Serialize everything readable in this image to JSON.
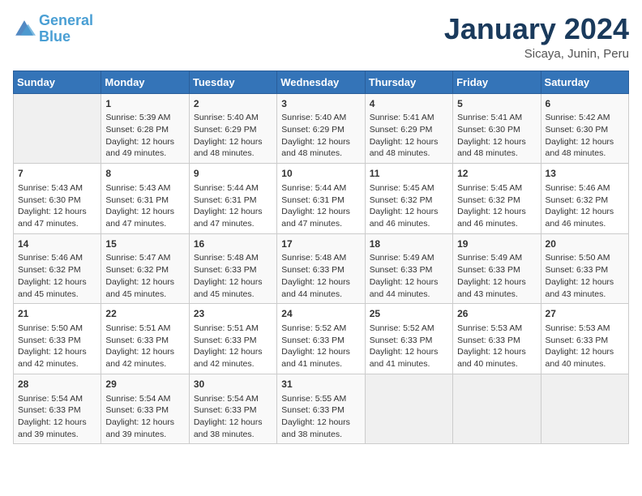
{
  "header": {
    "logo_general": "General",
    "logo_blue": "Blue",
    "month_title": "January 2024",
    "location": "Sicaya, Junin, Peru"
  },
  "days_of_week": [
    "Sunday",
    "Monday",
    "Tuesday",
    "Wednesday",
    "Thursday",
    "Friday",
    "Saturday"
  ],
  "weeks": [
    [
      {
        "day": "",
        "sunrise": "",
        "sunset": "",
        "daylight": ""
      },
      {
        "day": "1",
        "sunrise": "Sunrise: 5:39 AM",
        "sunset": "Sunset: 6:28 PM",
        "daylight": "Daylight: 12 hours and 49 minutes."
      },
      {
        "day": "2",
        "sunrise": "Sunrise: 5:40 AM",
        "sunset": "Sunset: 6:29 PM",
        "daylight": "Daylight: 12 hours and 48 minutes."
      },
      {
        "day": "3",
        "sunrise": "Sunrise: 5:40 AM",
        "sunset": "Sunset: 6:29 PM",
        "daylight": "Daylight: 12 hours and 48 minutes."
      },
      {
        "day": "4",
        "sunrise": "Sunrise: 5:41 AM",
        "sunset": "Sunset: 6:29 PM",
        "daylight": "Daylight: 12 hours and 48 minutes."
      },
      {
        "day": "5",
        "sunrise": "Sunrise: 5:41 AM",
        "sunset": "Sunset: 6:30 PM",
        "daylight": "Daylight: 12 hours and 48 minutes."
      },
      {
        "day": "6",
        "sunrise": "Sunrise: 5:42 AM",
        "sunset": "Sunset: 6:30 PM",
        "daylight": "Daylight: 12 hours and 48 minutes."
      }
    ],
    [
      {
        "day": "7",
        "sunrise": "Sunrise: 5:43 AM",
        "sunset": "Sunset: 6:30 PM",
        "daylight": "Daylight: 12 hours and 47 minutes."
      },
      {
        "day": "8",
        "sunrise": "Sunrise: 5:43 AM",
        "sunset": "Sunset: 6:31 PM",
        "daylight": "Daylight: 12 hours and 47 minutes."
      },
      {
        "day": "9",
        "sunrise": "Sunrise: 5:44 AM",
        "sunset": "Sunset: 6:31 PM",
        "daylight": "Daylight: 12 hours and 47 minutes."
      },
      {
        "day": "10",
        "sunrise": "Sunrise: 5:44 AM",
        "sunset": "Sunset: 6:31 PM",
        "daylight": "Daylight: 12 hours and 47 minutes."
      },
      {
        "day": "11",
        "sunrise": "Sunrise: 5:45 AM",
        "sunset": "Sunset: 6:32 PM",
        "daylight": "Daylight: 12 hours and 46 minutes."
      },
      {
        "day": "12",
        "sunrise": "Sunrise: 5:45 AM",
        "sunset": "Sunset: 6:32 PM",
        "daylight": "Daylight: 12 hours and 46 minutes."
      },
      {
        "day": "13",
        "sunrise": "Sunrise: 5:46 AM",
        "sunset": "Sunset: 6:32 PM",
        "daylight": "Daylight: 12 hours and 46 minutes."
      }
    ],
    [
      {
        "day": "14",
        "sunrise": "Sunrise: 5:46 AM",
        "sunset": "Sunset: 6:32 PM",
        "daylight": "Daylight: 12 hours and 45 minutes."
      },
      {
        "day": "15",
        "sunrise": "Sunrise: 5:47 AM",
        "sunset": "Sunset: 6:32 PM",
        "daylight": "Daylight: 12 hours and 45 minutes."
      },
      {
        "day": "16",
        "sunrise": "Sunrise: 5:48 AM",
        "sunset": "Sunset: 6:33 PM",
        "daylight": "Daylight: 12 hours and 45 minutes."
      },
      {
        "day": "17",
        "sunrise": "Sunrise: 5:48 AM",
        "sunset": "Sunset: 6:33 PM",
        "daylight": "Daylight: 12 hours and 44 minutes."
      },
      {
        "day": "18",
        "sunrise": "Sunrise: 5:49 AM",
        "sunset": "Sunset: 6:33 PM",
        "daylight": "Daylight: 12 hours and 44 minutes."
      },
      {
        "day": "19",
        "sunrise": "Sunrise: 5:49 AM",
        "sunset": "Sunset: 6:33 PM",
        "daylight": "Daylight: 12 hours and 43 minutes."
      },
      {
        "day": "20",
        "sunrise": "Sunrise: 5:50 AM",
        "sunset": "Sunset: 6:33 PM",
        "daylight": "Daylight: 12 hours and 43 minutes."
      }
    ],
    [
      {
        "day": "21",
        "sunrise": "Sunrise: 5:50 AM",
        "sunset": "Sunset: 6:33 PM",
        "daylight": "Daylight: 12 hours and 42 minutes."
      },
      {
        "day": "22",
        "sunrise": "Sunrise: 5:51 AM",
        "sunset": "Sunset: 6:33 PM",
        "daylight": "Daylight: 12 hours and 42 minutes."
      },
      {
        "day": "23",
        "sunrise": "Sunrise: 5:51 AM",
        "sunset": "Sunset: 6:33 PM",
        "daylight": "Daylight: 12 hours and 42 minutes."
      },
      {
        "day": "24",
        "sunrise": "Sunrise: 5:52 AM",
        "sunset": "Sunset: 6:33 PM",
        "daylight": "Daylight: 12 hours and 41 minutes."
      },
      {
        "day": "25",
        "sunrise": "Sunrise: 5:52 AM",
        "sunset": "Sunset: 6:33 PM",
        "daylight": "Daylight: 12 hours and 41 minutes."
      },
      {
        "day": "26",
        "sunrise": "Sunrise: 5:53 AM",
        "sunset": "Sunset: 6:33 PM",
        "daylight": "Daylight: 12 hours and 40 minutes."
      },
      {
        "day": "27",
        "sunrise": "Sunrise: 5:53 AM",
        "sunset": "Sunset: 6:33 PM",
        "daylight": "Daylight: 12 hours and 40 minutes."
      }
    ],
    [
      {
        "day": "28",
        "sunrise": "Sunrise: 5:54 AM",
        "sunset": "Sunset: 6:33 PM",
        "daylight": "Daylight: 12 hours and 39 minutes."
      },
      {
        "day": "29",
        "sunrise": "Sunrise: 5:54 AM",
        "sunset": "Sunset: 6:33 PM",
        "daylight": "Daylight: 12 hours and 39 minutes."
      },
      {
        "day": "30",
        "sunrise": "Sunrise: 5:54 AM",
        "sunset": "Sunset: 6:33 PM",
        "daylight": "Daylight: 12 hours and 38 minutes."
      },
      {
        "day": "31",
        "sunrise": "Sunrise: 5:55 AM",
        "sunset": "Sunset: 6:33 PM",
        "daylight": "Daylight: 12 hours and 38 minutes."
      },
      {
        "day": "",
        "sunrise": "",
        "sunset": "",
        "daylight": ""
      },
      {
        "day": "",
        "sunrise": "",
        "sunset": "",
        "daylight": ""
      },
      {
        "day": "",
        "sunrise": "",
        "sunset": "",
        "daylight": ""
      }
    ]
  ]
}
